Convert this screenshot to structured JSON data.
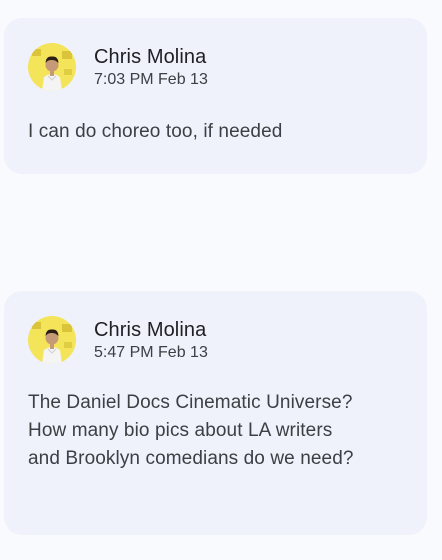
{
  "messages": [
    {
      "author": "Chris Molina",
      "timestamp": "7:03 PM Feb 13",
      "text": "I can do choreo too, if needed",
      "avatar_icon": "user-avatar-photo"
    },
    {
      "author": "Chris Molina",
      "timestamp": "5:47 PM Feb 13",
      "text": "The Daniel Docs Cinematic Universe? How many bio pics about LA writers and Brooklyn comedians do we need?",
      "avatar_icon": "user-avatar-photo"
    }
  ],
  "colors": {
    "page_background": "#f9fafe",
    "card_background": "#eff2fb",
    "author_text": "#202124",
    "secondary_text": "#3c4043",
    "avatar_yellow": "#f3e45a"
  }
}
